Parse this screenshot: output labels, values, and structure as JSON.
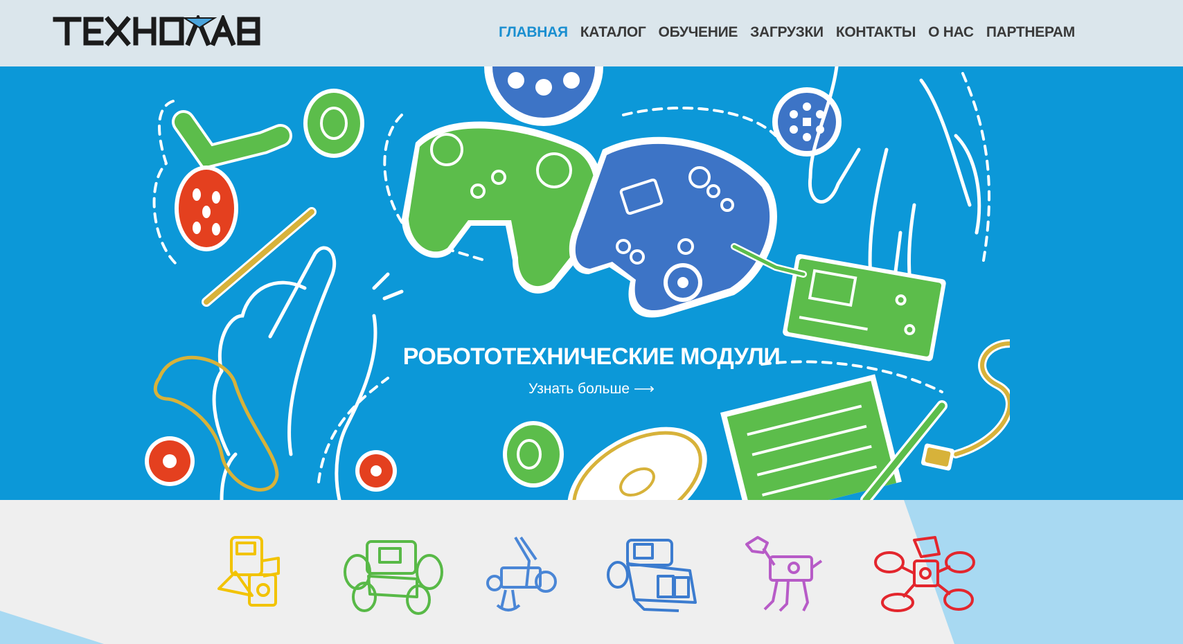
{
  "logo": {
    "text": "TEXHOЛAB"
  },
  "nav": {
    "items": [
      {
        "label": "ГЛАВНАЯ",
        "active": true
      },
      {
        "label": "КАТАЛОГ",
        "active": false
      },
      {
        "label": "ОБУЧЕНИЕ",
        "active": false
      },
      {
        "label": "ЗАГРУЗКИ",
        "active": false
      },
      {
        "label": "КОНТАКТЫ",
        "active": false
      },
      {
        "label": "О НАС",
        "active": false
      },
      {
        "label": "ПАРТНЕРАМ",
        "active": false
      }
    ]
  },
  "hero": {
    "title": "РОБОТОТЕХНИЧЕСКИЕ МОДУЛИ",
    "link": "Узнать больше ⟶"
  },
  "products": [
    {
      "name": "yellow-robot-icon",
      "color": "#f2c300"
    },
    {
      "name": "green-rover-icon",
      "color": "#58b947"
    },
    {
      "name": "blue-arm-robot-icon",
      "color": "#4a86d6"
    },
    {
      "name": "blue-vehicle-icon",
      "color": "#3c7ccf"
    },
    {
      "name": "purple-dog-robot-icon",
      "color": "#b75bc7"
    },
    {
      "name": "red-drone-icon",
      "color": "#e3262d"
    }
  ],
  "colors": {
    "accent": "#1b8fd0",
    "hero_bg": "#0c98d8",
    "header_bg": "#dbe6ec",
    "green": "#5cbd4b",
    "dark_blue": "#3d74c6",
    "red": "#e4401f",
    "gold": "#d7b23a"
  }
}
